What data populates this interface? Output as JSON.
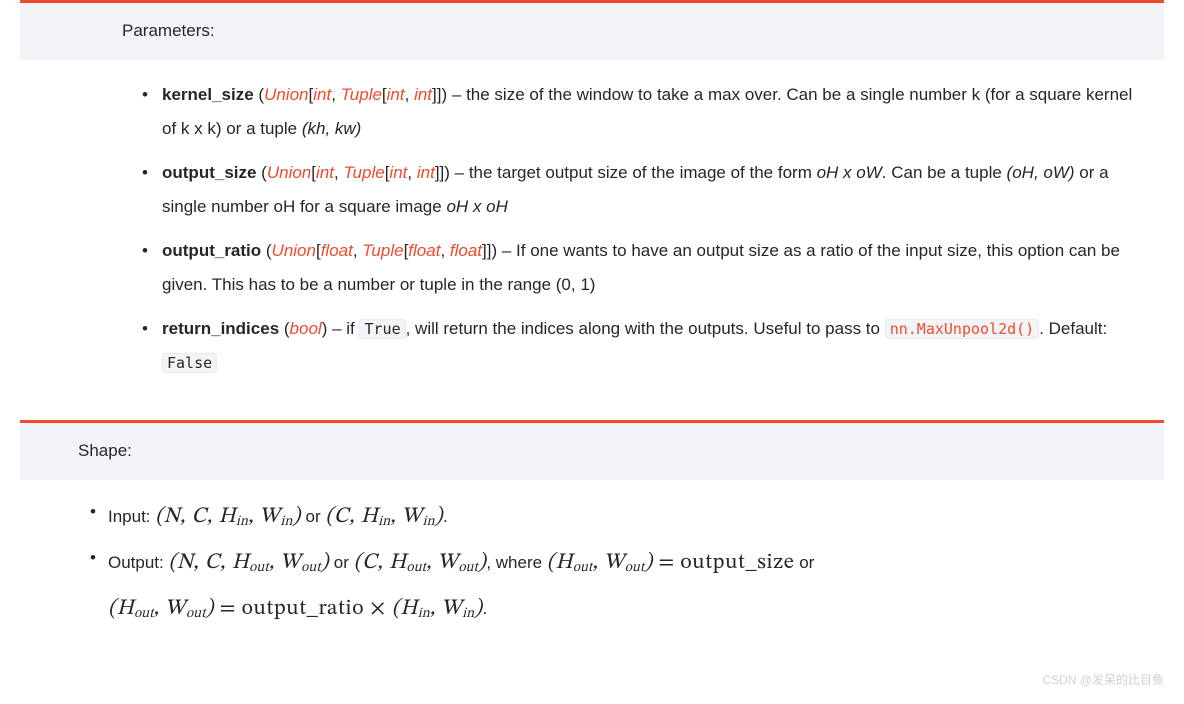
{
  "parameters": {
    "heading": "Parameters:",
    "items": [
      {
        "name": "kernel_size",
        "type_html": "<span class='ptype'>Union</span>[<span class='ptype'>int</span>, <span class='ptype'>Tuple</span>[<span class='ptype'>int</span>, <span class='ptype'>int</span>]]",
        "desc_html": "the size of the window to take a max over. Can be a single number k (for a square kernel of k x k) or a tuple <span class='em-it'>(kh, kw)</span>"
      },
      {
        "name": "output_size",
        "type_html": "<span class='ptype'>Union</span>[<span class='ptype'>int</span>, <span class='ptype'>Tuple</span>[<span class='ptype'>int</span>, <span class='ptype'>int</span>]]",
        "desc_html": "the target output size of the image of the form <span class='em-it'>oH x oW</span>. Can be a tuple <span class='em-it'>(oH, oW)</span> or a single number oH for a square image <span class='em-it'>oH x oH</span>"
      },
      {
        "name": "output_ratio",
        "type_html": "<span class='ptype'>Union</span>[<span class='ptype'>float</span>, <span class='ptype'>Tuple</span>[<span class='ptype'>float</span>, <span class='ptype'>float</span>]]",
        "desc_html": "If one wants to have an output size as a ratio of the input size, this option can be given. This has to be a number or tuple in the range (0, 1)"
      },
      {
        "name": "return_indices",
        "type_html": "<span class='ptype'>bool</span>",
        "desc_html": "if <span class='codelit'>True</span>, will return the indices along with the outputs. Useful to pass to <span class='codelink'>nn.MaxUnpool2d()</span>. Default: <span class='codelit'>False</span>"
      }
    ]
  },
  "shape": {
    "heading": "Shape:",
    "input_label": "Input:",
    "output_label": "Output:",
    "where_text": ", where",
    "or_text": "or",
    "eq_output_size": "output_size",
    "eq_output_ratio": "output_ratio"
  },
  "watermark": "CSDN @发呆的比目鱼"
}
